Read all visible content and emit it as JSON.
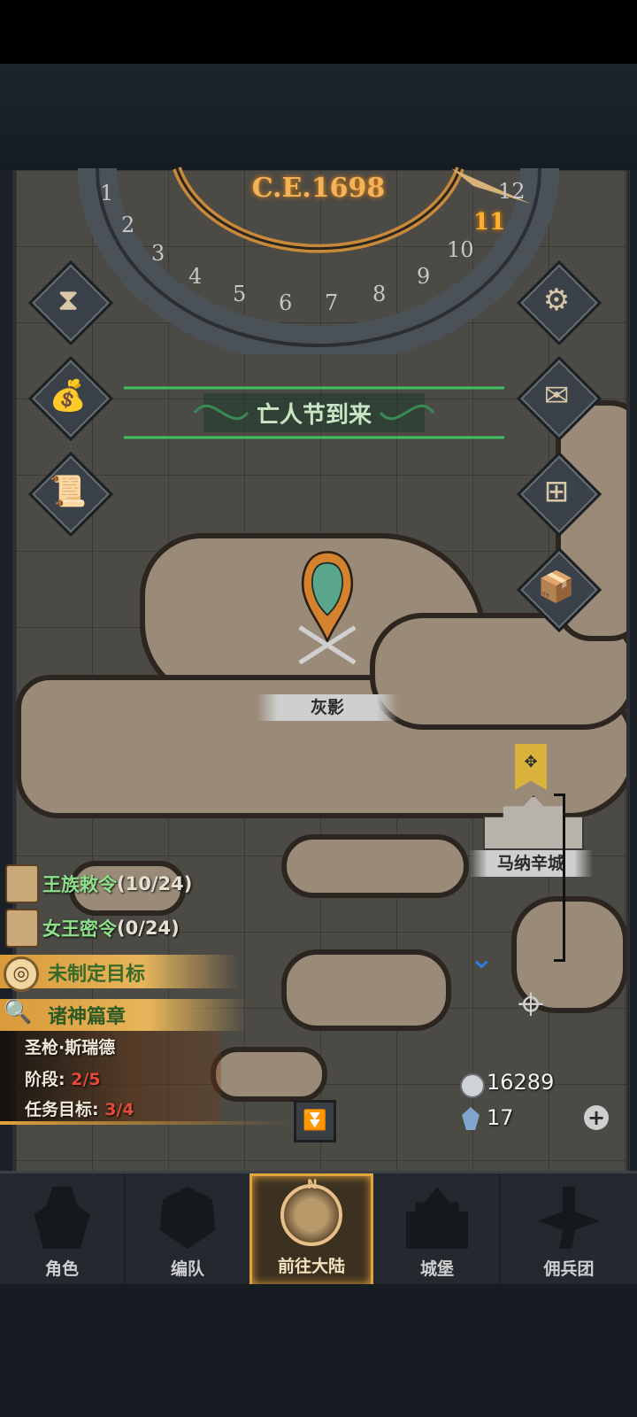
{
  "calendar": {
    "year": "C.E.1698",
    "months": [
      "1",
      "2",
      "3",
      "4",
      "5",
      "6",
      "7",
      "8",
      "9",
      "10",
      "11",
      "12"
    ],
    "current_month": "11"
  },
  "event_banner": "亡人节到来",
  "map_markers": {
    "enemy_label": "灰影",
    "city_label": "马纳辛城"
  },
  "side_buttons_left": [
    "hourglass-icon",
    "money-bag-icon",
    "scroll-icon"
  ],
  "side_buttons_right": [
    "gear-icon",
    "mail-icon",
    "grid-icon",
    "supplies-icon"
  ],
  "quests": [
    {
      "name": "王族敕令",
      "count": "(10/24)"
    },
    {
      "name": "女王密令",
      "count": "(0/24)"
    }
  ],
  "goal": "未制定目标",
  "chapter": {
    "title": "诸神篇章",
    "hero": "圣枪·斯瑞德",
    "stage_label": "阶段:",
    "stage_value": "2/5",
    "target_label": "任务目标:",
    "target_value": "3/4"
  },
  "resources": {
    "silver": "16289",
    "crystal": "17"
  },
  "nav": {
    "compass_letter": "N",
    "tabs": [
      {
        "label": "角色"
      },
      {
        "label": "编队"
      },
      {
        "label": "前往大陆"
      },
      {
        "label": "城堡"
      },
      {
        "label": "佣兵团"
      }
    ],
    "active_index": 2
  }
}
